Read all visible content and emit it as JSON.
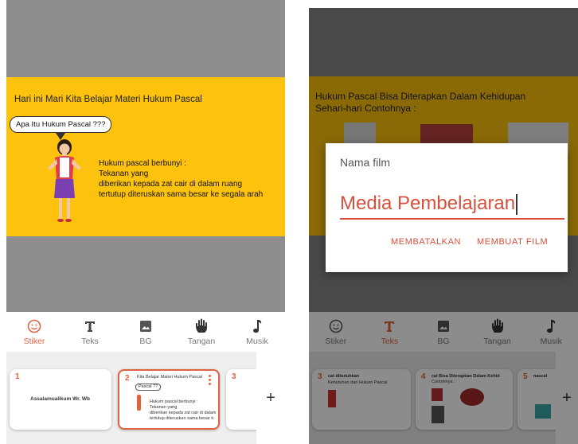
{
  "left": {
    "slide": {
      "title": "Hari ini Mari Kita Belajar Materi Hukum Pascal",
      "bubble": "Apa Itu Hukum Pascal ???",
      "fact_lines": [
        "Hukum pascal berbunyi :",
        "Tekanan yang",
        "diberikan kepada zat cair di dalam ruang",
        "tertutup diteruskan sama besar ke segala arah"
      ]
    },
    "toolbar": [
      {
        "label": "Stiker",
        "icon": "smiley-icon",
        "active": true
      },
      {
        "label": "Teks",
        "icon": "text-icon",
        "active": false
      },
      {
        "label": "BG",
        "icon": "image-icon",
        "active": false
      },
      {
        "label": "Tangan",
        "icon": "hand-icon",
        "active": false
      },
      {
        "label": "Musik",
        "icon": "music-note-icon",
        "active": false
      }
    ],
    "thumbs": [
      {
        "num": "1",
        "text": "Assalamualikum Wr. Wb"
      },
      {
        "num": "2",
        "title": "Kita Belajar Materi Hukum Pascal",
        "bubble": "Pascal ??",
        "lines": [
          "Hukum pascal berbunyi :",
          "Tekanan yang",
          "diberikan kepada zat cair di dalam",
          "tertutup diteruskan sama besar k"
        ]
      },
      {
        "num": "3"
      }
    ],
    "add_label": "+"
  },
  "right": {
    "slide": {
      "title_line1": "Hukum Pascal Bisa Diterapkan Dalam Kehidupan",
      "title_line2": "Sehari-hari Contohnya :"
    },
    "dialog": {
      "title": "Nama film",
      "value": "Media Pembelajaran",
      "cancel": "MEMBATALKAN",
      "confirm": "MEMBUAT FILM"
    },
    "toolbar": [
      {
        "label": "Stiker",
        "icon": "smiley-icon",
        "active": false
      },
      {
        "label": "Teks",
        "icon": "text-icon",
        "active": true
      },
      {
        "label": "BG",
        "icon": "image-icon",
        "active": false
      },
      {
        "label": "Tangan",
        "icon": "hand-icon",
        "active": false
      },
      {
        "label": "Musik",
        "icon": "music-note-icon",
        "active": false
      }
    ],
    "thumbs": [
      {
        "num": "3",
        "title": "cat dibutuhkan",
        "sub": "Kebutuhan dari Hukum Pascal"
      },
      {
        "num": "4",
        "title": "cal Bisa Diterapkan Dalam Kehid",
        "sub": "Contohnya :"
      },
      {
        "num": "5",
        "title": "nascal"
      }
    ],
    "add_label": "+"
  },
  "colors": {
    "accent": "#e0633f",
    "slide_bg": "#fcc20e",
    "stage_gray": "#8e8e8e"
  }
}
